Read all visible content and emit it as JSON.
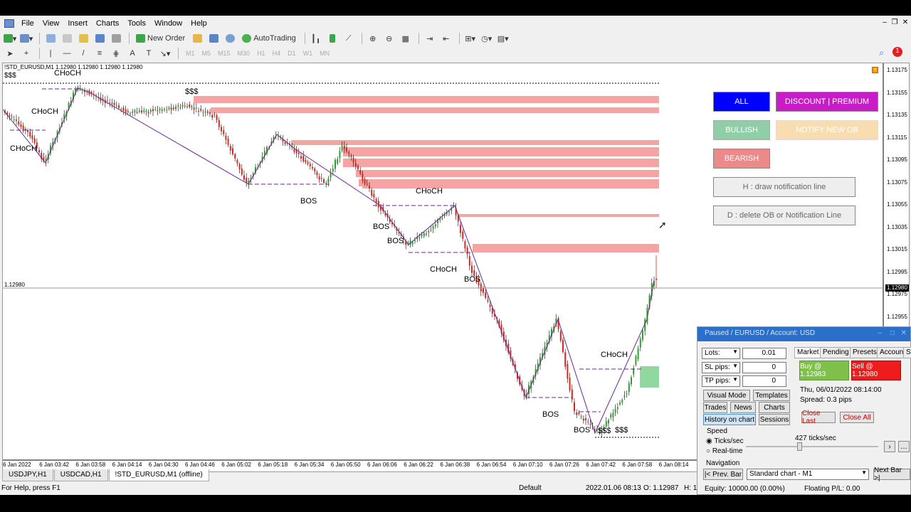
{
  "menu": [
    "File",
    "View",
    "Insert",
    "Charts",
    "Tools",
    "Window",
    "Help"
  ],
  "toolbar": {
    "new_order": "New Order",
    "autotrading": "AutoTrading",
    "timeframes": [
      "M1",
      "M5",
      "M15",
      "M30",
      "H1",
      "H4",
      "D1",
      "W1",
      "MN"
    ]
  },
  "chart": {
    "symbol_info": "!STD_EURUSD,M1  1.12980 1.12980 1.12980 1.12980",
    "dollar_label": "$$$",
    "current_price_label": "1.12980",
    "current_price_tag": "1.12980",
    "price_levels": [
      "1.13175",
      "1.13155",
      "1.13135",
      "1.13115",
      "1.13095",
      "1.13075",
      "1.13055",
      "1.13035",
      "1.13015",
      "1.12995",
      "1.12975",
      "1.12955",
      "1.12935"
    ],
    "time_labels": [
      "6 Jan 2022",
      "6 Jan 03:42",
      "6 Jan 03:58",
      "6 Jan 04:14",
      "6 Jan 04:30",
      "6 Jan 04:46",
      "6 Jan 05:02",
      "6 Jan 05:18",
      "6 Jan 05:34",
      "6 Jan 05:50",
      "6 Jan 06:06",
      "6 Jan 06:22",
      "6 Jan 06:38",
      "6 Jan 06:54",
      "6 Jan 07:10",
      "6 Jan 07:26",
      "6 Jan 07:42",
      "6 Jan 07:58",
      "6 Jan 08:14"
    ],
    "structure_labels": [
      "CHoCH",
      "CHoCH",
      "CHoCH",
      "$$$",
      "BOS",
      "CHoCH",
      "BOS",
      "BOS",
      "CHoCH",
      "BOS",
      "BOS",
      "CHoCH",
      "BOS",
      "$$$",
      "$$$"
    ],
    "colors": {
      "bear_candle": "#e0241b",
      "bull_candle": "#2aa12a",
      "bear_ob": "#f5a3a3",
      "bull_ob": "#8fd8a0"
    }
  },
  "ea_panel": {
    "all": "ALL",
    "discount_premium": "DISCOUNT | PREMIUM",
    "bullish": "BULLISH",
    "notify_new_ob": "NOTIFY NEW OB",
    "bearish": "BEARISH",
    "draw_line": "H : draw notification line",
    "delete_ob": "D : delete OB or Notification Line"
  },
  "tabs": [
    "USDJPY,H1",
    "USDCAD,H1",
    "!STD_EURUSD,M1 (offline)"
  ],
  "status": {
    "help": "For Help, press F1",
    "profile": "Default",
    "datetime": "2022.01.06 08:13",
    "open": "O: 1.12987",
    "high": "H: 1"
  },
  "tester": {
    "title": "Paused / EURUSD / Account: USD",
    "lots_label": "Lots:",
    "lots_value": "0.01",
    "sl_label": "SL pips:",
    "sl_value": "0",
    "tp_label": "TP pips:",
    "tp_value": "0",
    "tabs": [
      "Market",
      "Pending",
      "Presets",
      "Account",
      "Save"
    ],
    "buy": "Buy @ 1.12983",
    "sell": "Sell @ 1.12980",
    "datetime": "Thu, 06/01/2022  08:14:00",
    "spread": "Spread:  0.3 pips",
    "visual_mode": "Visual Mode",
    "templates": "Templates",
    "trades": "Trades",
    "news": "News",
    "charts": "Charts",
    "history": "History on chart",
    "sessions": "Sessions",
    "close_last": "Close Last",
    "close_all": "Close All",
    "speed_label": "Speed",
    "ticks_per_sec": "Ticks/sec",
    "realtime": "Real-time",
    "ticks_value": "427 ticks/sec",
    "navigation": "Navigation",
    "prev_bar": "|< Prev. Bar",
    "chart_type": "Standard chart - M1",
    "next_bar": "Next Bar >|",
    "equity": "Equity:  10000.00  (0.00%)",
    "floating": "Floating P/L:  0.00"
  }
}
